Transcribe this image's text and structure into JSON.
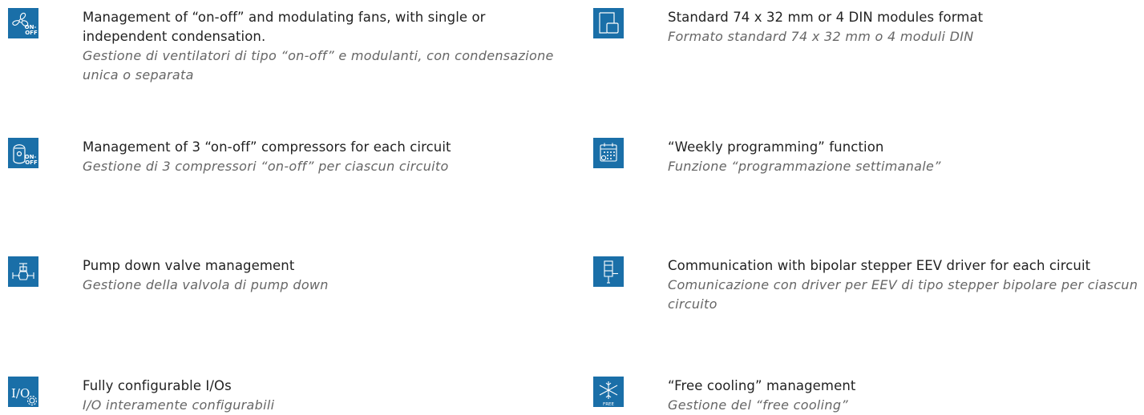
{
  "features": [
    {
      "icon": "fan-on-off-icon",
      "title": "Management of “on-off” and modulating fans, with single or independent condensation.",
      "subtitle": "Gestione di ventilatori di tipo “on-off” e modulanti, con condensazione unica o separata"
    },
    {
      "icon": "module-format-icon",
      "title": "Standard 74 x 32 mm or 4 DIN modules format",
      "subtitle": "Formato standard 74 x 32 mm o 4 moduli DIN"
    },
    {
      "icon": "compressor-on-off-icon",
      "title": "Management of 3 “on-off” compressors for each circuit",
      "subtitle": "Gestione di 3 compressori “on-off” per ciascun circuito"
    },
    {
      "icon": "weekly-calendar-icon",
      "title": "“Weekly programming” function",
      "subtitle": "Funzione “programmazione settimanale”"
    },
    {
      "icon": "pump-down-valve-icon",
      "title": "Pump down valve management",
      "subtitle": "Gestione della valvola di pump down"
    },
    {
      "icon": "eev-driver-icon",
      "title": "Communication with bipolar stepper EEV driver for each circuit",
      "subtitle": "Comunicazione con driver per EEV di tipo stepper bipolare per ciascun circuito"
    },
    {
      "icon": "io-config-icon",
      "title": "Fully configurable I/Os",
      "subtitle": "I/O interamente configurabili",
      "icon_text": "I/O"
    },
    {
      "icon": "free-cooling-icon",
      "title": "“Free cooling” management",
      "subtitle": "Gestione del “free cooling”",
      "icon_text": "FREE"
    }
  ],
  "icon_labels": {
    "on_off_line1": "ON-",
    "on_off_line2": "OFF"
  },
  "colors": {
    "icon_bg": "#1a6fa8",
    "title": "#222222",
    "subtitle": "#666666"
  }
}
